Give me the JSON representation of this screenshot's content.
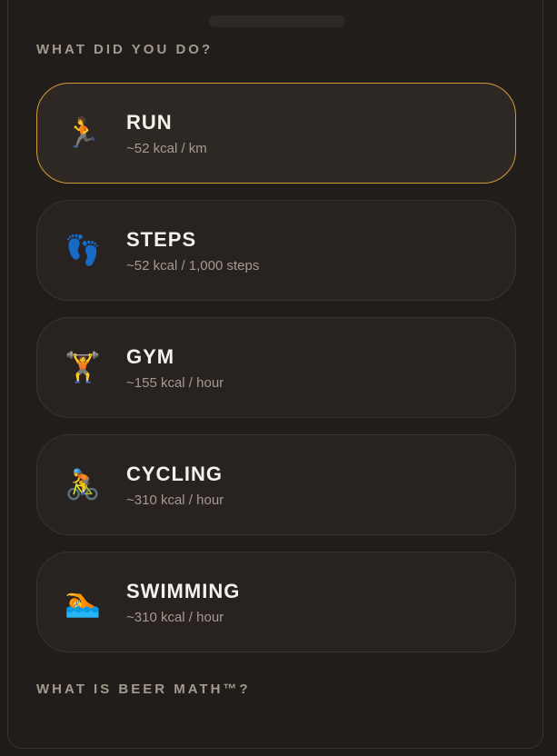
{
  "section_title": "WHAT DID YOU DO?",
  "footer_title": "WHAT IS BEER MATH™?",
  "activities": [
    {
      "name": "RUN",
      "desc": "~52 kcal / km",
      "icon": "runner-icon",
      "glyph": "🏃",
      "selected": true
    },
    {
      "name": "STEPS",
      "desc": "~52 kcal / 1,000 steps",
      "icon": "footprints-icon",
      "glyph": "👣",
      "selected": false
    },
    {
      "name": "GYM",
      "desc": "~155 kcal / hour",
      "icon": "weightlifter-icon",
      "glyph": "🏋",
      "selected": false
    },
    {
      "name": "CYCLING",
      "desc": "~310 kcal / hour",
      "icon": "cyclist-icon",
      "glyph": "🚴",
      "selected": false
    },
    {
      "name": "SWIMMING",
      "desc": "~310 kcal / hour",
      "icon": "swimmer-icon",
      "glyph": "🏊",
      "selected": false
    }
  ],
  "colors": {
    "accent_border": "#d39a3a",
    "background": "#211d1a",
    "card": "#282320"
  }
}
